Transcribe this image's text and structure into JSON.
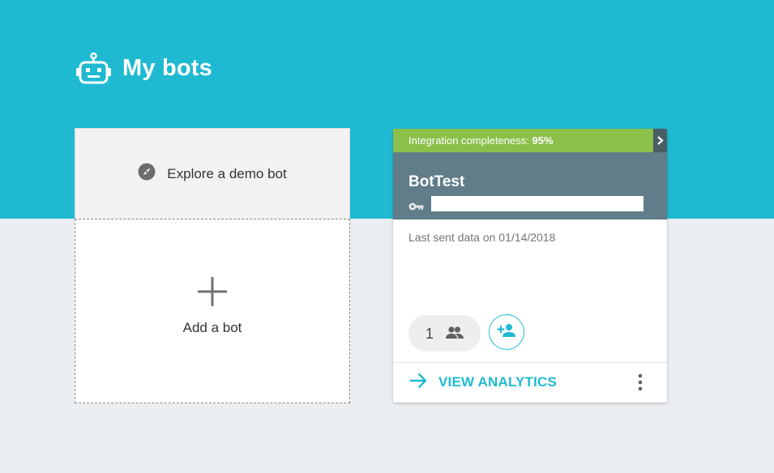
{
  "header": {
    "title": "My bots",
    "icon": "robot-icon"
  },
  "colors": {
    "hero_bg": "#1fbad2",
    "page_bg": "#ebeef1",
    "integration_green": "#8bc04b",
    "bot_header": "#607d89",
    "accent": "#1fbad2"
  },
  "demo": {
    "label": "Explore a demo bot",
    "icon": "compass-icon"
  },
  "add_bot": {
    "label": "Add a bot",
    "icon": "plus-icon"
  },
  "bot_card": {
    "integration_label": "Integration completeness: ",
    "integration_percent": "95%",
    "integration_value": 0.95,
    "name": "BotTest",
    "key_value": "",
    "key_icon": "key-icon",
    "last_sent": "Last sent data on 01/14/2018",
    "members_count": "1",
    "members_icon": "people-icon",
    "add_member_icon": "add-person-icon",
    "view_analytics_label": "VIEW ANALYTICS",
    "more_icon": "more-vertical-icon"
  }
}
